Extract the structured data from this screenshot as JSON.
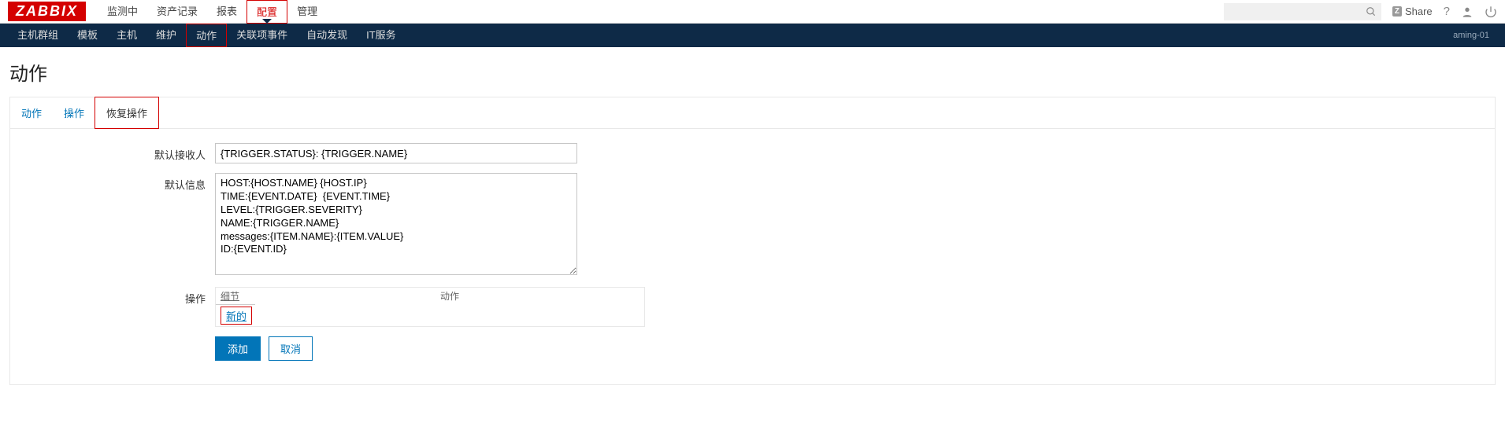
{
  "logo_text": "ZABBIX",
  "topnav": [
    "监测中",
    "资产记录",
    "报表",
    "配置",
    "管理"
  ],
  "topnav_active_index": 3,
  "share_label": "Share",
  "subnav": [
    "主机群组",
    "模板",
    "主机",
    "维护",
    "动作",
    "关联项事件",
    "自动发现",
    "IT服务"
  ],
  "subnav_active_index": 4,
  "host_label": "aming-01",
  "page_title": "动作",
  "tabs": [
    "动作",
    "操作",
    "恢复操作"
  ],
  "tab_active_index": 2,
  "form": {
    "recipient_label": "默认接收人",
    "recipient_value": "{TRIGGER.STATUS}: {TRIGGER.NAME}",
    "message_label": "默认信息",
    "message_value": "HOST:{HOST.NAME} {HOST.IP}\nTIME:{EVENT.DATE}  {EVENT.TIME}\nLEVEL:{TRIGGER.SEVERITY}\nNAME:{TRIGGER.NAME}\nmessages:{ITEM.NAME}:{ITEM.VALUE}\nID:{EVENT.ID}",
    "ops_label": "操作",
    "ops_col_detail": "细节",
    "ops_col_action": "动作",
    "ops_new": "新的",
    "btn_add": "添加",
    "btn_cancel": "取消"
  }
}
